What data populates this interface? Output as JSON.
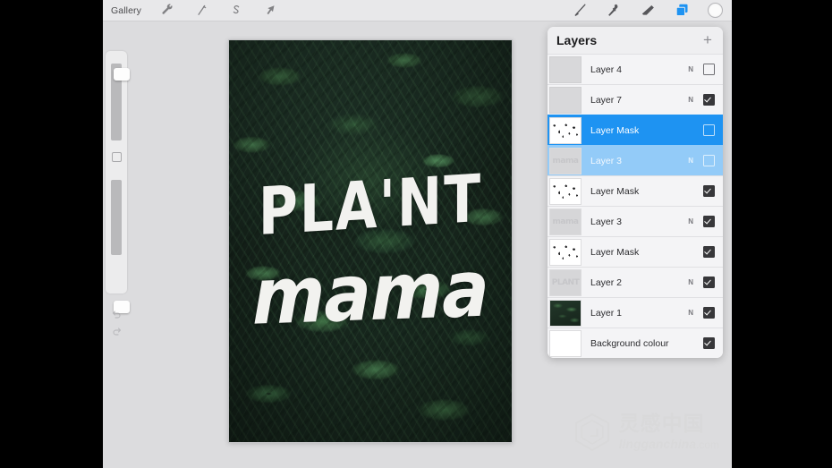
{
  "app": {
    "name": "Procreate",
    "background_color": "#dcdcde",
    "accent_color": "#1e93f2"
  },
  "toolbar": {
    "gallery_label": "Gallery",
    "left_tools": [
      {
        "name": "actions-wrench-icon",
        "label": "Actions"
      },
      {
        "name": "adjustments-wand-icon",
        "label": "Adjustments"
      },
      {
        "name": "selection-icon",
        "label": "Selection"
      },
      {
        "name": "transform-arrow-icon",
        "label": "Transform"
      }
    ],
    "right_tools": [
      {
        "name": "paint-brush-icon",
        "label": "Paint",
        "active": false
      },
      {
        "name": "smudge-icon",
        "label": "Smudge",
        "active": false
      },
      {
        "name": "eraser-icon",
        "label": "Erase",
        "active": false
      },
      {
        "name": "layers-icon",
        "label": "Layers",
        "active": true
      }
    ],
    "color_swatch": "#fbfbfb"
  },
  "sidebar": {
    "brush_size_label": "Brush size",
    "opacity_label": "Opacity",
    "modify_label": "Modify",
    "undo_label": "Undo",
    "redo_label": "Redo"
  },
  "canvas": {
    "artwork_line1": "PLA'NT",
    "artwork_line2": "mama",
    "text_color": "#f2f2ef"
  },
  "layers_panel": {
    "title": "Layers",
    "add_button_label": "+",
    "rows": [
      {
        "name": "Layer 4",
        "blend": "N",
        "visible": false,
        "selected": "none",
        "thumb": "empty"
      },
      {
        "name": "Layer 7",
        "blend": "N",
        "visible": true,
        "selected": "none",
        "thumb": "empty"
      },
      {
        "name": "Layer Mask",
        "blend": "",
        "visible": false,
        "selected": "primary",
        "thumb": "mask"
      },
      {
        "name": "Layer 3",
        "blend": "N",
        "visible": false,
        "selected": "secondary",
        "thumb": "mama"
      },
      {
        "name": "Layer Mask",
        "blend": "",
        "visible": true,
        "selected": "none",
        "thumb": "mask"
      },
      {
        "name": "Layer 3",
        "blend": "N",
        "visible": true,
        "selected": "none",
        "thumb": "mama"
      },
      {
        "name": "Layer Mask",
        "blend": "",
        "visible": true,
        "selected": "none",
        "thumb": "mask"
      },
      {
        "name": "Layer 2",
        "blend": "N",
        "visible": true,
        "selected": "none",
        "thumb": "plant"
      },
      {
        "name": "Layer 1",
        "blend": "N",
        "visible": true,
        "selected": "none",
        "thumb": "photo"
      },
      {
        "name": "Background colour",
        "blend": "",
        "visible": true,
        "selected": "none",
        "thumb": "white"
      }
    ]
  },
  "watermark": {
    "chinese": "灵感中国",
    "latin": "lingganchina",
    "domain": ".com"
  }
}
